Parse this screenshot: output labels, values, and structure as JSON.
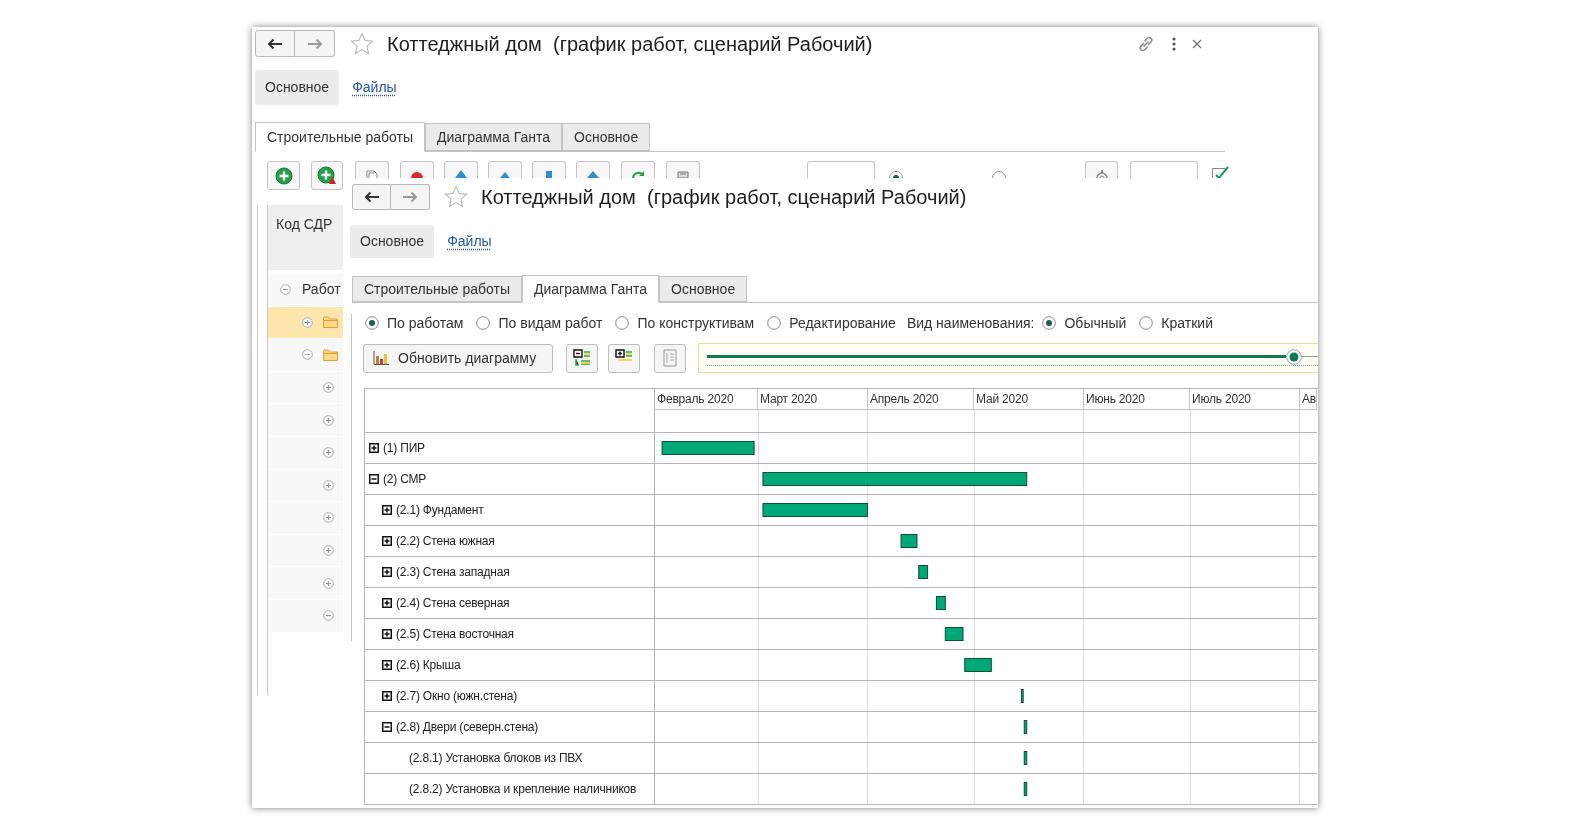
{
  "back_window": {
    "title": "Коттеджный дом  (график работ, сценарий Рабочий)",
    "sections": [
      {
        "label": "Основное",
        "selected": true
      },
      {
        "label": "Файлы",
        "selected": false
      }
    ],
    "tabs": [
      {
        "label": "Строительные работы",
        "selected": true
      },
      {
        "label": "Диаграмма Ганта",
        "selected": false
      },
      {
        "label": "Основное",
        "selected": false
      }
    ],
    "toolbar_options": [
      {
        "selected": true
      },
      {
        "selected": false
      }
    ],
    "tree": {
      "header": "Код СДР",
      "rows": [
        {
          "kind": "group",
          "label": "Работ",
          "expanded": true,
          "selected": false,
          "children": [
            {
              "kind": "folder",
              "expanded": false,
              "selected": true
            },
            {
              "kind": "folder",
              "expanded": true,
              "selected": false,
              "children": [
                {
                  "expanded": false,
                  "selected": false
                },
                {
                  "expanded": false,
                  "selected": false
                },
                {
                  "expanded": false,
                  "selected": false
                },
                {
                  "expanded": false,
                  "selected": false
                },
                {
                  "expanded": false,
                  "selected": false
                },
                {
                  "expanded": false,
                  "selected": false
                },
                {
                  "expanded": false,
                  "selected": false
                },
                {
                  "expanded": true,
                  "selected": false
                }
              ]
            }
          ]
        }
      ]
    }
  },
  "front_window": {
    "title": "Коттеджный дом  (график работ, сценарий Рабочий)",
    "sections": [
      {
        "label": "Основное",
        "selected": true
      },
      {
        "label": "Файлы",
        "selected": false
      }
    ],
    "tabs": [
      {
        "label": "Строительные работы",
        "selected": false
      },
      {
        "label": "Диаграмма Ганта",
        "selected": true
      },
      {
        "label": "Основное",
        "selected": false
      }
    ],
    "view_modes": [
      {
        "label": "По работам",
        "selected": true
      },
      {
        "label": "По видам работ",
        "selected": false
      },
      {
        "label": "По конструктивам",
        "selected": false
      },
      {
        "label": "Редактирование",
        "selected": false
      }
    ],
    "name_view": {
      "label": "Вид наименования:",
      "options": [
        {
          "label": "Обычный",
          "selected": true
        },
        {
          "label": "Краткий",
          "selected": false
        }
      ]
    },
    "refresh_button": {
      "label": "Обновить диаграмму"
    },
    "scale_slider": {
      "level": 0.96
    },
    "gantt": {
      "months": [
        "Февраль 2020",
        "Март 2020",
        "Апрель 2020",
        "Май 2020",
        "Июнь 2020",
        "Июль 2020",
        "Ав"
      ],
      "rows": [
        {
          "label": "(1) ПИР",
          "expanded": false
        },
        {
          "label": "(2) СМР",
          "expanded": true,
          "children": [
            {
              "label": "(2.1) Фундамент",
              "expanded": false
            },
            {
              "label": "(2.2) Стена южная",
              "expanded": false
            },
            {
              "label": "(2.3) Стена западная",
              "expanded": false
            },
            {
              "label": "(2.4) Стена северная",
              "expanded": false
            },
            {
              "label": "(2.5) Стена восточная",
              "expanded": false
            },
            {
              "label": "(2.6) Крыша",
              "expanded": false
            },
            {
              "label": "(2.7) Окно (южн.стена)",
              "expanded": false
            },
            {
              "label": "(2.8) Двери (северн.стена)",
              "expanded": true,
              "children": [
                {
                  "label": "(2.8.1) Установка блоков из ПВХ"
                },
                {
                  "label": "(2.8.2) Установка и крепление наличников"
                }
              ]
            }
          ]
        }
      ]
    }
  }
}
